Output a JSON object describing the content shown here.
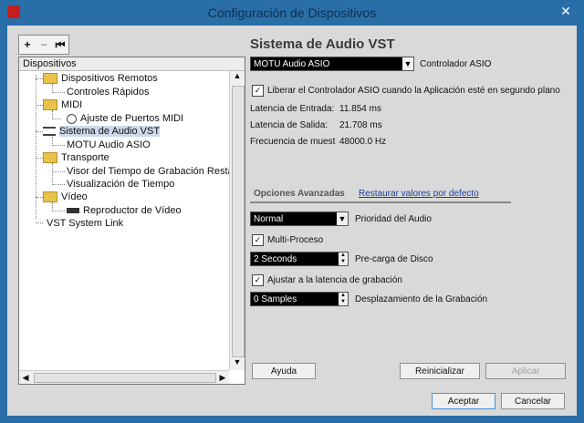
{
  "window": {
    "title": "Configuración de Dispositivos",
    "close_glyph": "✕"
  },
  "toolbar": {
    "add": "+",
    "remove": "−",
    "reset": "⏮"
  },
  "tree": {
    "header": "Dispositivos",
    "items": [
      {
        "label": "Dispositivos Remotos"
      },
      {
        "label": "Controles Rápidos"
      },
      {
        "label": "MIDI"
      },
      {
        "label": "Ajuste de Puertos MIDI"
      },
      {
        "label": "Sistema de Audio VST"
      },
      {
        "label": "MOTU Audio ASIO"
      },
      {
        "label": "Transporte"
      },
      {
        "label": "Visor del Tiempo de Grabación Restante"
      },
      {
        "label": "Visualización de Tiempo"
      },
      {
        "label": "Vídeo"
      },
      {
        "label": "Reproductor de Vídeo"
      },
      {
        "label": "VST System Link"
      }
    ]
  },
  "panel": {
    "title": "Sistema de Audio VST",
    "driver_value": "MOTU Audio ASIO",
    "driver_label": "Controlador ASIO",
    "release_label": "Liberar el Controlador ASIO cuando la Aplicación esté en segundo plano",
    "input_latency_label": "Latencia de Entrada:",
    "input_latency_value": "11.854 ms",
    "output_latency_label": "Latencia de Salida:",
    "output_latency_value": "21.708 ms",
    "sample_rate_label": "Frecuencia de muest",
    "sample_rate_value": "48000.0 Hz",
    "advanced_title": "Opciones Avanzadas",
    "restore_link": "Restaurar valores por defecto",
    "priority_value": "Normal",
    "priority_label": "Prioridad del Audio",
    "multiprocess_label": "Multi-Proceso",
    "preload_value": "2 Seconds",
    "preload_label": "Pre-carga de Disco",
    "adjust_label": "Ajustar a la latencia de grabación",
    "offset_value": "0 Samples",
    "offset_label": "Desplazamiento de la Grabación"
  },
  "buttons": {
    "help": "Ayuda",
    "reset": "Reinicializar",
    "apply": "Aplicar",
    "accept": "Aceptar",
    "cancel": "Cancelar"
  },
  "checkmarks": {
    "release": "✓",
    "multiprocess": "✓",
    "adjust": "✓"
  }
}
